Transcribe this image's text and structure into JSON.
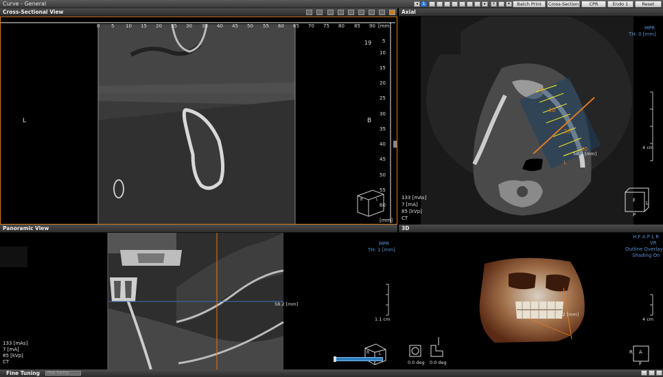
{
  "window": {
    "title": "Curve - General"
  },
  "toolbar": {
    "page_number": "1",
    "buttons": [
      "Batch Print",
      "Cross-Section",
      "CPR",
      "Endo 1",
      "Reset"
    ]
  },
  "cross_section": {
    "title": "Cross-Sectional View",
    "ruler_top": [
      "0",
      "5",
      "10",
      "15",
      "20",
      "25",
      "30",
      "35",
      "40",
      "45",
      "50",
      "55",
      "60",
      "65",
      "70",
      "75",
      "80",
      "85",
      "90"
    ],
    "ruler_top_unit": "[mm]",
    "ruler_right": [
      "5",
      "10",
      "15",
      "20",
      "25",
      "30",
      "35",
      "40",
      "45",
      "50",
      "55",
      "60"
    ],
    "ruler_right_unit": "[mm]",
    "slice_number": "19",
    "left_label": "L",
    "right_label": "B",
    "cube_labels": [
      "B",
      "L"
    ]
  },
  "axial": {
    "title": "Axial",
    "mode": "MPR",
    "thickness": "TH: 0 [mm]",
    "scale": "4 cm",
    "tooth_numbers": [
      "4",
      "10",
      "20",
      "30"
    ],
    "measurement": "58.2 [mm]",
    "side_label": "L",
    "tech": [
      "133 [mAs]",
      "7 [mA]",
      "85 [kVp]",
      "CT"
    ],
    "orient_cube": [
      "F",
      "L",
      "P"
    ]
  },
  "panoramic": {
    "title": "Panoramic View",
    "mode": "MPR",
    "thickness": "TH: 1 [mm]",
    "measurement": "58.2 [mm]",
    "scale": "1.1 cm",
    "tech": [
      "133 [mAs]",
      "7 [mA]",
      "85 [kVp]",
      "CT"
    ],
    "cube_labels": [
      "R",
      "L"
    ]
  },
  "view3d": {
    "title": "3D",
    "orient_row": "H F A P L R",
    "mode": "VR",
    "outline": "Outline Overlay",
    "shading": "Shading On",
    "scale": "4 cm",
    "measurement": "58.2 [mm]",
    "rotate1": "0.0 deg",
    "rotate2": "0.0 deg",
    "orient_cube": [
      "R",
      "A",
      "F"
    ]
  },
  "bottom": {
    "title": "Fine Tuning",
    "slider_text": "Fine Tuning"
  },
  "colors": {
    "accent": "#3e7ed8",
    "overlay_blue": "#5a8fd0",
    "orange": "#e07a20",
    "yellow": "#e8e020"
  }
}
